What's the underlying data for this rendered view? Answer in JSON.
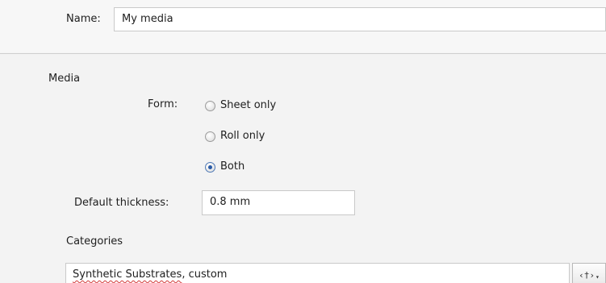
{
  "name_field": {
    "label": "Name:",
    "value": "My media"
  },
  "media_section": {
    "heading": "Media",
    "form": {
      "label": "Form:",
      "options": [
        {
          "label": "Sheet only",
          "checked": false
        },
        {
          "label": "Roll only",
          "checked": false
        },
        {
          "label": "Both",
          "checked": true
        }
      ]
    },
    "default_thickness": {
      "label": "Default thickness:",
      "value": "0.8 mm"
    }
  },
  "categories": {
    "heading": "Categories",
    "value_part1": "Synthetic Substrates",
    "value_part2": ", custom",
    "tag_button_label": "‹†›",
    "tag_button_caret": "▾"
  },
  "colors": {
    "accent": "#2a5aa6",
    "spellcheck": "#d23a3a"
  }
}
